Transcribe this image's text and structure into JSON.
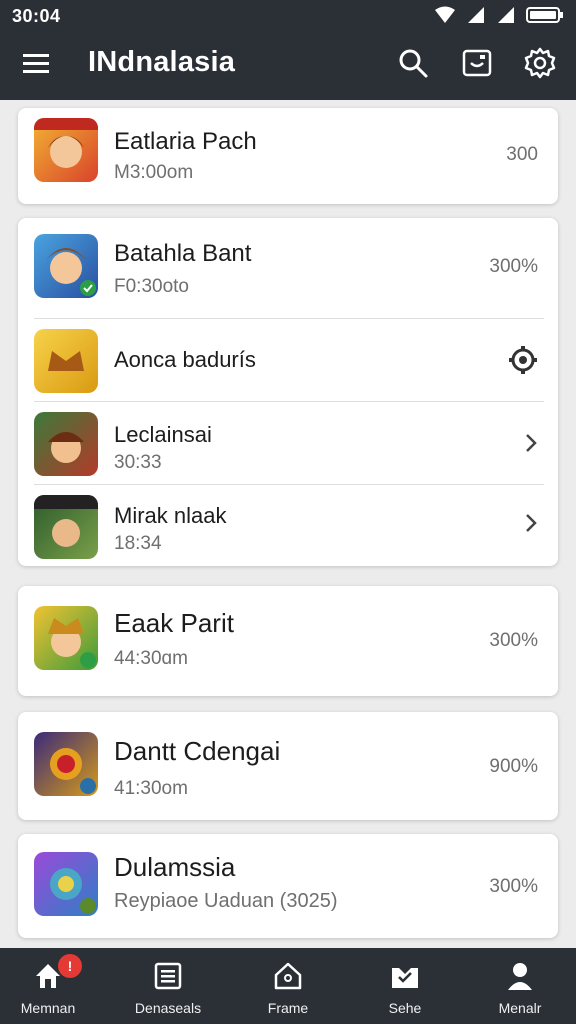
{
  "status_bar": {
    "time": "30:04",
    "icons": [
      "wifi-icon",
      "signal-icon",
      "signal-icon",
      "battery-icon"
    ]
  },
  "app_bar": {
    "title": "INdnalasia",
    "actions": [
      "search-icon",
      "screen-icon",
      "gear-icon"
    ]
  },
  "cards": [
    {
      "rows": [
        {
          "title": "Eatlaria Pach",
          "subtitle": "M3:00om",
          "right": "300"
        }
      ]
    },
    {
      "rows": [
        {
          "title": "Batahla Bant",
          "subtitle": "F0:30oto",
          "right": "300%"
        },
        {
          "title": "Aonca badurís",
          "right_icon": "settings-gear-icon"
        },
        {
          "title": "Leclainsai",
          "subtitle": "30:33",
          "right_icon": "chevron-right-icon"
        },
        {
          "title": "Mirak nlaak",
          "subtitle": "18:34",
          "right_icon": "chevron-right-icon"
        }
      ]
    },
    {
      "rows": [
        {
          "title": "Eaak Parit",
          "subtitle": "44:30ɑm",
          "right": "300%"
        }
      ]
    },
    {
      "rows": [
        {
          "title": "Dantt Cdengai",
          "subtitle": "41:30om",
          "right": "900%"
        }
      ]
    },
    {
      "rows": [
        {
          "title": "Dulamssia",
          "subtitle": "Reypiaoe Uaduan (3025)",
          "right": "300%"
        }
      ]
    }
  ],
  "bottom_nav": {
    "items": [
      {
        "label": "Memnan",
        "icon": "home-icon",
        "badge": "!"
      },
      {
        "label": "Denaseals",
        "icon": "list-icon"
      },
      {
        "label": "Frame",
        "icon": "house-outline-icon"
      },
      {
        "label": "Sehe",
        "icon": "inbox-icon"
      },
      {
        "label": "Menalr",
        "icon": "person-icon"
      }
    ]
  },
  "colors": {
    "bar": "#2b2f36",
    "background": "#ececec",
    "card": "#ffffff",
    "badge": "#e53935"
  }
}
